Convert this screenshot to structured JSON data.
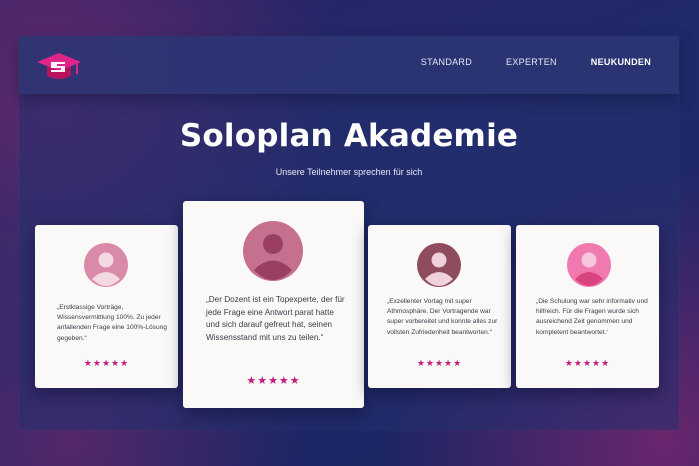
{
  "header": {
    "nav": [
      "STANDARD",
      "EXPERTEN",
      "NEUKUNDEN"
    ],
    "active_nav": "NEUKUNDEN"
  },
  "hero": {
    "title": "Soloplan Akademie",
    "subtitle": "Unsere Teilnehmer sprechen für sich"
  },
  "testimonials": [
    {
      "quote": "„Erstklassige Vorträge, Wissensvermittlung 100%. Zu jeder anfallenden Frage eine 100%-Lösung gegeben.“",
      "stars": "★★★★★",
      "rating": 5,
      "avatar_color": "#d98aa8"
    },
    {
      "quote": "„Der Dozent ist ein Topexperte, der für jede Frage eine Antwort parat hatte und sich darauf gefreut hat, seinen Wissensstand mit uns zu teilen.“",
      "stars": "★★★★★",
      "rating": 5,
      "avatar_color": "#c4708e"
    },
    {
      "quote": "„Exzellenter Vortag mit super Athmosphäre. Der Vortragende war super vorbereitet und konnte alles zur vollsten Zufriedenheit beantworten.“",
      "stars": "★★★★★",
      "rating": 5,
      "avatar_color": "#8e4c5e"
    },
    {
      "quote": "„Die Schulung war sehr informativ und hilfreich. Für die Fragen wurde sich ausreichend Zeit genommen und kompletent beantwortet.‘",
      "stars": "★★★★★",
      "rating": 5,
      "avatar_color": "#f07ab0"
    }
  ],
  "colors": {
    "accent": "#c21c7c",
    "logo": "#d4187a"
  }
}
